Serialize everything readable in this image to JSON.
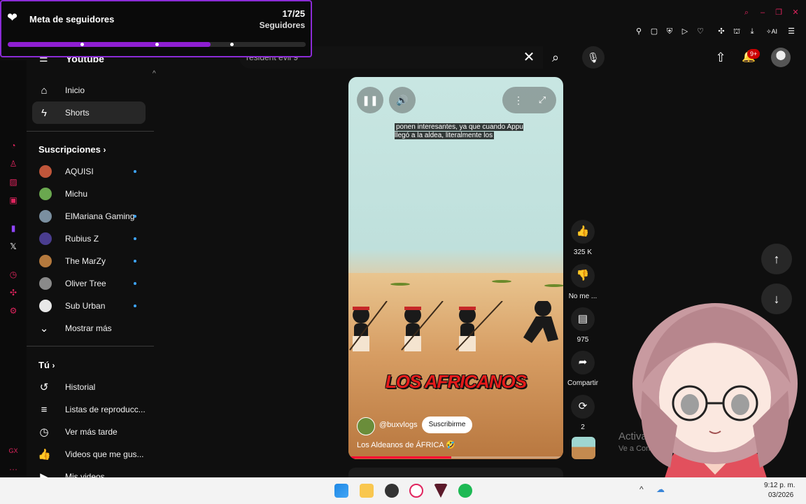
{
  "widget": {
    "title": "Meta de seguidores",
    "count": "17/25",
    "subtitle": "Seguidores",
    "progress": 0.68,
    "accent": "#8e1fd1"
  },
  "header": {
    "logo": "Youtube",
    "search_value": "resident evil 9",
    "notifications_badge": "9+"
  },
  "sidebar": {
    "items": [
      {
        "label": "Inicio",
        "icon": "home-icon"
      },
      {
        "label": "Shorts",
        "icon": "shorts-icon"
      }
    ],
    "subs_title": "Suscripciones",
    "subscriptions": [
      {
        "label": "AQUISI",
        "color": "#c0563a"
      },
      {
        "label": "Michu",
        "color": "#6aa84f"
      },
      {
        "label": "ElMariana Gaming",
        "color": "#7a8fa0"
      },
      {
        "label": "Rubius Z",
        "color": "#4a3d8f"
      },
      {
        "label": "The MarZy",
        "color": "#b4793d"
      },
      {
        "label": "Oliver Tree",
        "color": "#8a8a8a"
      },
      {
        "label": "Sub Urban",
        "color": "#e8e8e8"
      }
    ],
    "show_more": "Mostrar más",
    "you_title": "Tú",
    "you_items": [
      {
        "label": "Historial",
        "icon": "history-icon"
      },
      {
        "label": "Listas de reproducc...",
        "icon": "playlist-icon"
      },
      {
        "label": "Ver más tarde",
        "icon": "clock-icon"
      },
      {
        "label": "Videos que me gus...",
        "icon": "like-icon"
      },
      {
        "label": "Mis videos",
        "icon": "video-icon"
      }
    ]
  },
  "video": {
    "caption": "ponen interesantes, ya que cuando Appu llegó a la aldea, literalmente los",
    "overlay_title": "LOS AFRICANOS",
    "channel": "@buxvlogs",
    "subscribe": "Suscribirme",
    "title": "Los Aldeanos de ÁFRICA 🤣",
    "progress": 0.48
  },
  "actions": {
    "likes": "325 K",
    "dislike": "No me ...",
    "comments": "975",
    "share": "Compartir",
    "remix": "2"
  },
  "watermark": {
    "title": "Activar Windows",
    "subtitle": "Ve a Configuración para activar Windows."
  },
  "taskbar": {
    "time": "9:12 p. m.",
    "date": "03/2026"
  }
}
